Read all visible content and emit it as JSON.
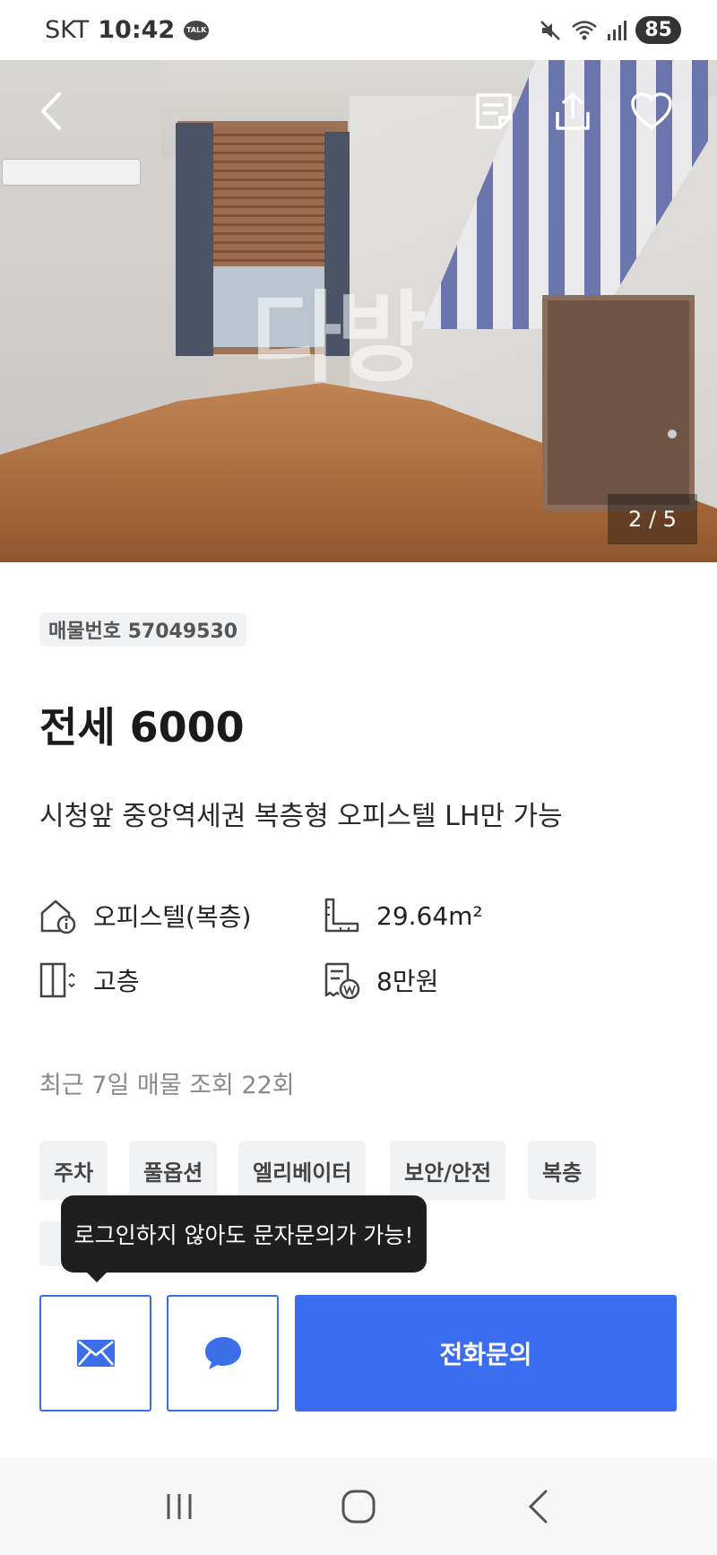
{
  "status_bar": {
    "carrier": "SKT",
    "time": "10:42",
    "talk_badge": "TALK",
    "battery": "85"
  },
  "hero": {
    "watermark": "다방",
    "page_counter": "2 / 5"
  },
  "listing": {
    "id_label": "매물번호 57049530",
    "price": "전세 6000",
    "title": "시청앞 중앙역세권 복층형 오피스텔 LH만 가능"
  },
  "specs": {
    "type": "오피스텔(복층)",
    "area": "29.64m²",
    "floor": "고층",
    "maintenance_fee": "8만원"
  },
  "views": "최근 7일 매물 조회 22회",
  "tags": [
    "주차",
    "풀옵션",
    "엘리베이터",
    "보안/안전",
    "복층"
  ],
  "tooltip": "로그인하지 않아도 문자문의가 가능!",
  "actions": {
    "call": "전화문의"
  },
  "colors": {
    "primary": "#3a6df0",
    "outline": "#3a6fe8"
  }
}
